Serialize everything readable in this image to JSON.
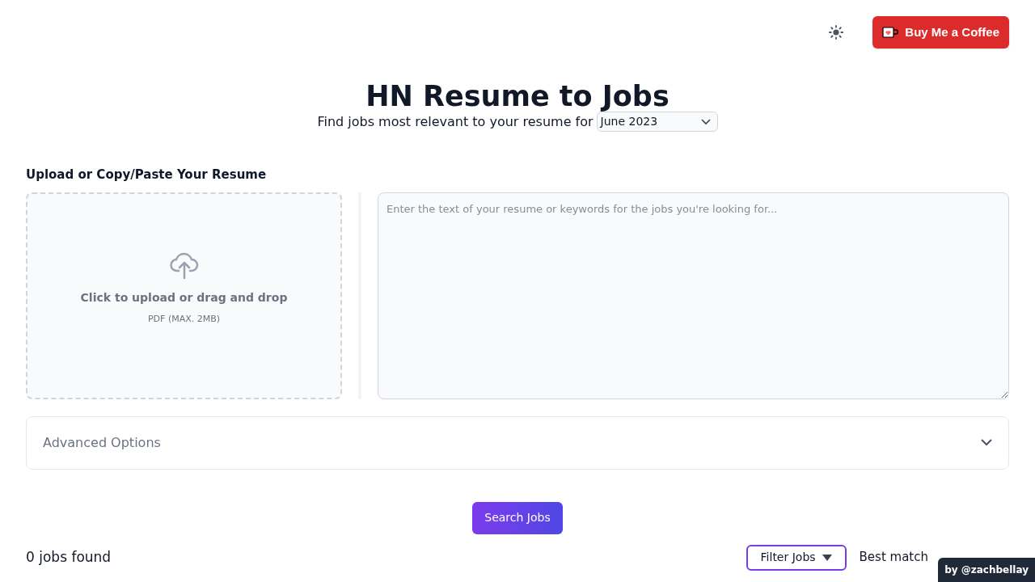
{
  "header": {
    "coffee_button": "Buy Me a Coffee"
  },
  "hero": {
    "title": "HN Resume to Jobs",
    "subtitle": "Find jobs most relevant to your resume for",
    "month_select": {
      "value": "June 2023"
    }
  },
  "upload": {
    "heading": "Upload or Copy/Paste Your Resume",
    "dropzone_text": "Click to upload or drag and drop",
    "dropzone_hint": "PDF (MAX. 2MB)",
    "textarea": {
      "placeholder": "Enter the text of your resume or keywords for the jobs you're looking for..."
    }
  },
  "advanced_options": {
    "label": "Advanced Options",
    "expanded": false
  },
  "search_button": "Search Jobs",
  "results": {
    "count": "0 jobs found",
    "filter_button": "Filter Jobs",
    "sort": "Best match"
  },
  "credit_badge": "by @zachbellay"
}
